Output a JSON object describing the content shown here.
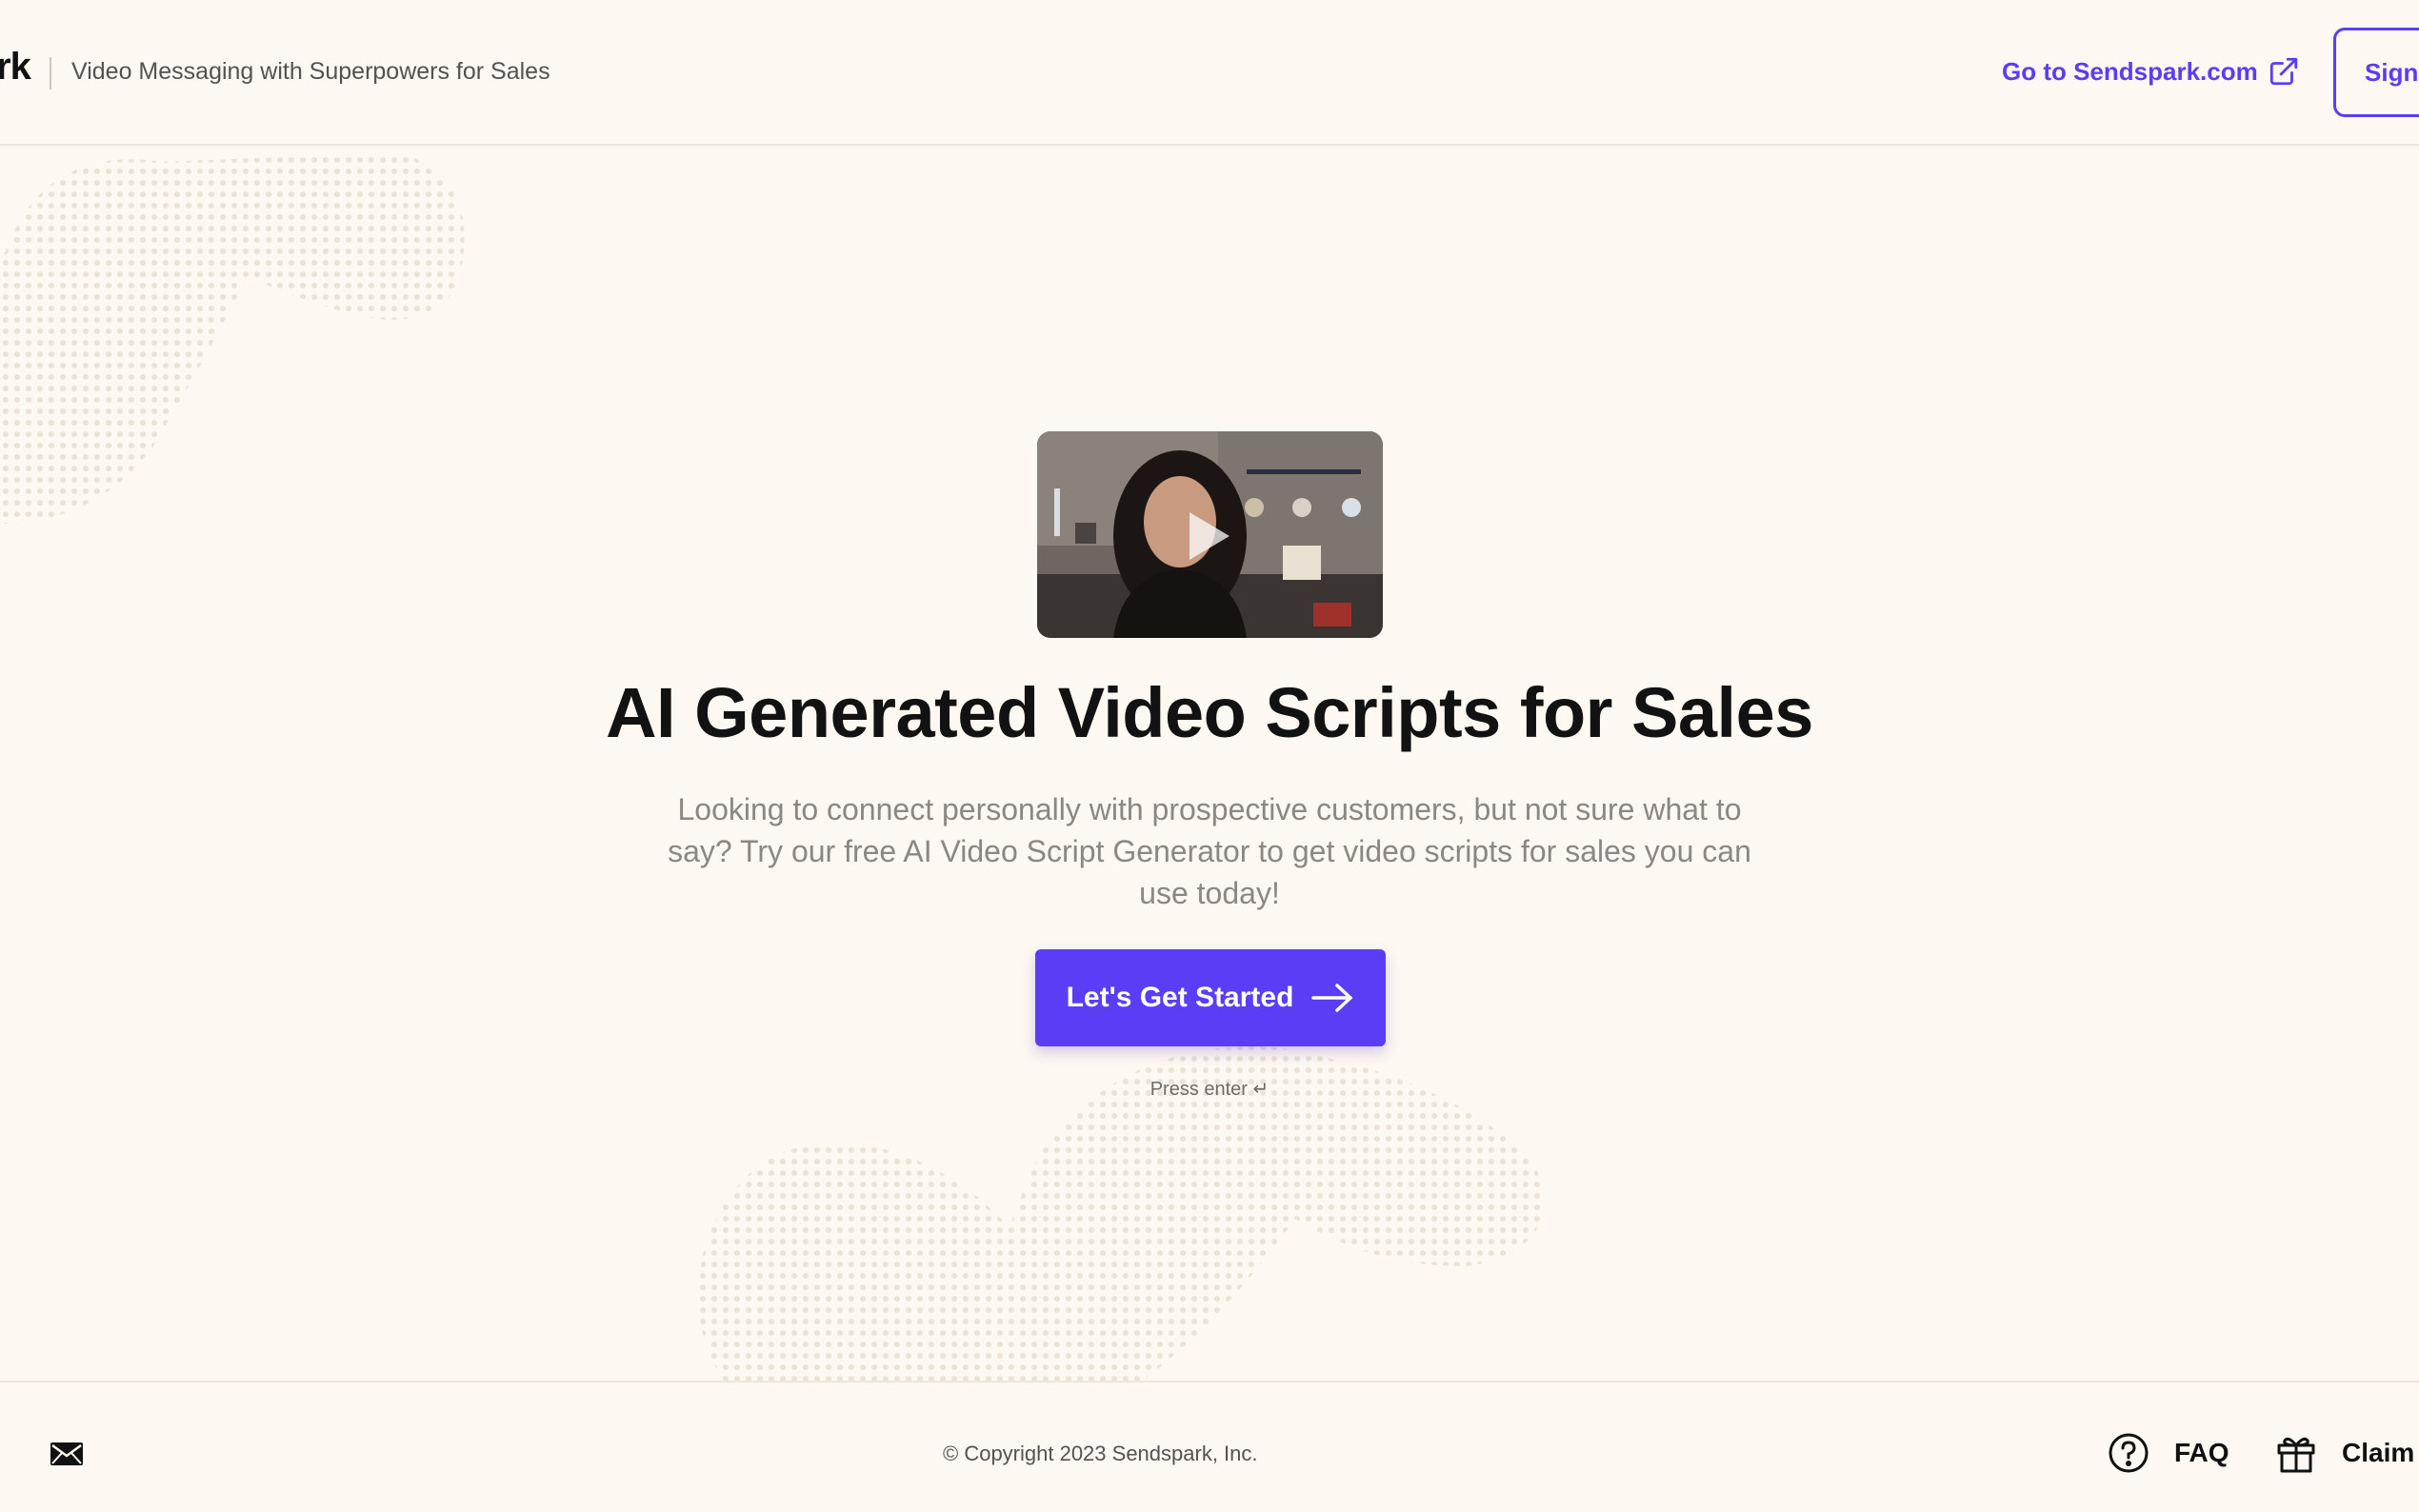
{
  "header": {
    "logo_fragment": "rk",
    "tagline": "Video Messaging with Superpowers for Sales",
    "site_link": "Go to Sendspark.com",
    "signin_label": "Sign"
  },
  "hero": {
    "video_play_icon": "play-icon",
    "headline": "AI Generated Video Scripts for Sales",
    "description": "Looking to connect personally with prospective customers, but not sure what to say? Try our free AI Video Script Generator to get video scripts for sales you can use today!",
    "cta_label": "Let's Get Started",
    "cta_icon": "arrow-right-icon",
    "press_hint": "Press enter ↵"
  },
  "footer": {
    "mail_icon": "mail-icon",
    "copyright": "© Copyright 2023 Sendspark, Inc.",
    "faq_label": "FAQ",
    "claim_label": "Claim C"
  },
  "colors": {
    "background": "#fdf8f1",
    "accent": "#5b3df5",
    "heading": "#121212",
    "muted_text": "#8c8781"
  }
}
